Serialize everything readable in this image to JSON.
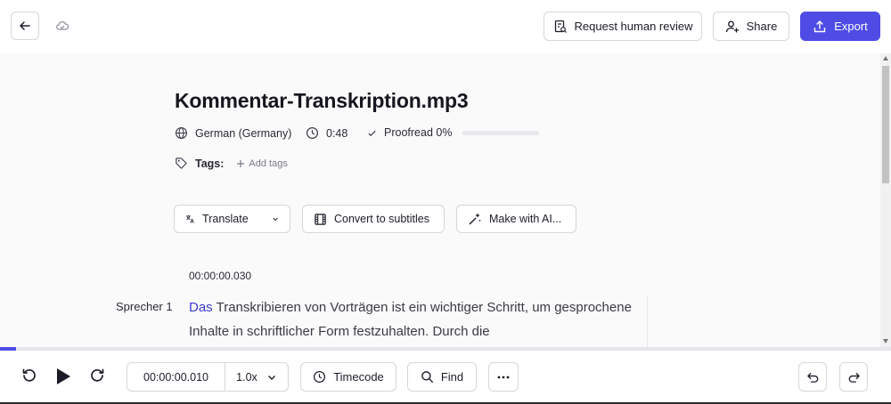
{
  "header": {
    "request_review_label": "Request human review",
    "share_label": "Share",
    "export_label": "Export",
    "accent_color": "#4f4ce6"
  },
  "file": {
    "title": "Kommentar-Transkription.mp3",
    "language": "German (Germany)",
    "duration": "0:48",
    "proofread_label": "Proofread 0%",
    "proofread_progress": 0,
    "tags_label": "Tags:",
    "add_tags_label": "Add tags"
  },
  "actions": {
    "translate_label": "Translate",
    "subtitles_label": "Convert to subtitles",
    "ai_label": "Make with AI..."
  },
  "transcript": {
    "timestamp": "00:00:00.030",
    "speaker": "Sprecher 1",
    "highlight_word": "Das",
    "text_rest": "Transkribieren von Vorträgen ist ein wichtiger Schritt, um gesprochene Inhalte in schriftlicher Form festzuhalten. Durch die"
  },
  "player": {
    "current_time": "00:00:00.010",
    "speed": "1.0x",
    "timecode_label": "Timecode",
    "find_label": "Find",
    "progress": 0.018
  },
  "icons": [
    "back-arrow-icon",
    "cloud-sync-icon",
    "review-doc-icon",
    "add-user-icon",
    "upload-icon",
    "globe-icon",
    "clock-icon",
    "check-icon",
    "tag-icon",
    "plus-icon",
    "translate-icon",
    "film-icon",
    "sparkle-icon",
    "chevron-down-icon",
    "rewind-icon",
    "play-icon",
    "forward-icon",
    "search-icon",
    "more-icon",
    "undo-icon",
    "redo-icon"
  ]
}
